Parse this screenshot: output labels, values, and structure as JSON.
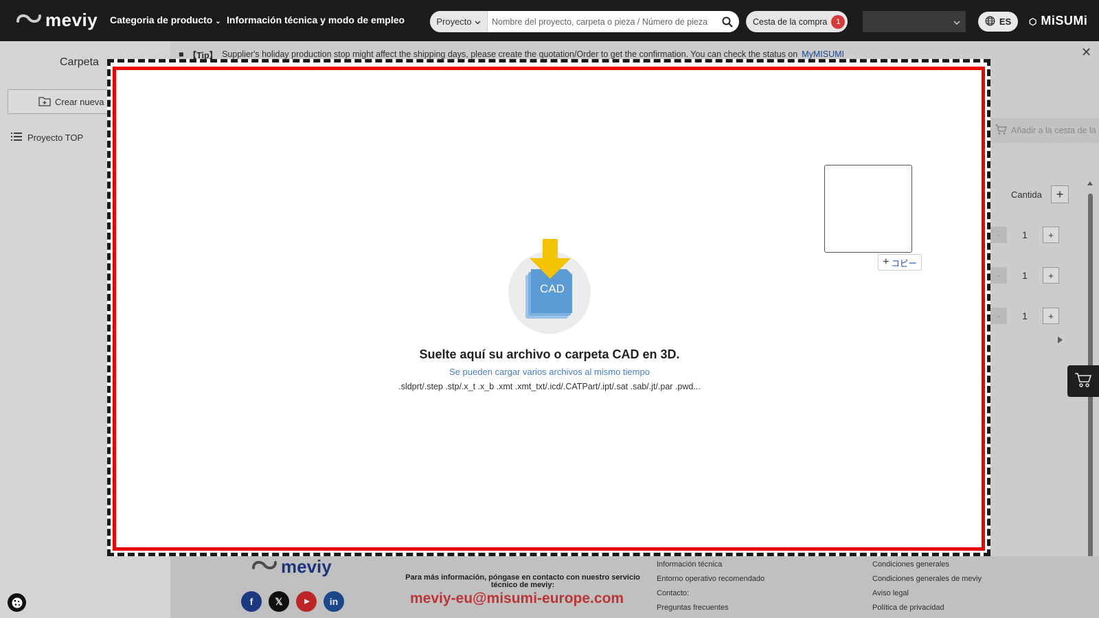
{
  "header": {
    "logo_text": "meviy",
    "nav": {
      "product_category": "Categoria de producto",
      "tech_info": "Información técnica y modo de empleo"
    },
    "search": {
      "scope": "Proyecto",
      "placeholder": "Nombre del proyecto, carpeta o pieza / Número de pieza"
    },
    "cart": {
      "label": "Cesta de la compra",
      "count": "1"
    },
    "language": "ES",
    "misumi_logo": "MiSUMi"
  },
  "sidebar": {
    "title": "Carpeta",
    "create_button": "Crear nueva",
    "project_top": "Proyecto TOP"
  },
  "tip": {
    "label": "【Tip】",
    "text": "Supplier's holiday production stop might affect the shipping days, please create the quotation/Order to get the confirmation. You can check the status on",
    "link": "MyMISUMI"
  },
  "main": {
    "add_to_cart": "Añadir a la cesta de la",
    "quantity_header": "Cantida",
    "quantities": [
      "1",
      "1",
      "1"
    ]
  },
  "dropzone": {
    "icon_label": "CAD",
    "title": "Suelte aquí su archivo o carpeta CAD en 3D.",
    "subtitle": "Se pueden cargar varios archivos al mismo tiempo",
    "extensions": ".sldprt/.step .stp/.x_t .x_b .xmt .xmt_txt/.icd/.CATPart/.ipt/.sat .sab/.jt/.par .pwd...",
    "copy_button": "コピー"
  },
  "footer": {
    "logo_text": "meviy",
    "contact_text": "Para más información, póngase en contacto con nuestro servicio técnico de meviy:",
    "email": "meviy-eu@misumi-europe.com",
    "links_col1": [
      "Información técnica",
      "Entorno operativo recomendado",
      "Contacto:",
      "Preguntas frecuentes"
    ],
    "links_col2": [
      "Condiciones generales",
      "Condiciones generales de meviy",
      "Aviso legal",
      "Política de privacidad"
    ]
  },
  "colors": {
    "header_bg": "#1b1b1b",
    "drop_border_red": "#ee0000",
    "link_blue": "#4a7cc9",
    "email_red": "#d23b3b",
    "cad_blue": "#5b9bd5",
    "arrow_yellow": "#f5c400"
  },
  "icons": [
    "meviy-logo-icon",
    "chevron-down-icon",
    "search-icon",
    "globe-icon",
    "misumi-icon",
    "folder-plus-icon",
    "list-icon",
    "close-icon",
    "cart-icon",
    "cad-upload-icon",
    "plus-icon",
    "cookie-icon",
    "facebook-icon",
    "x-icon",
    "youtube-icon",
    "linkedin-icon"
  ]
}
